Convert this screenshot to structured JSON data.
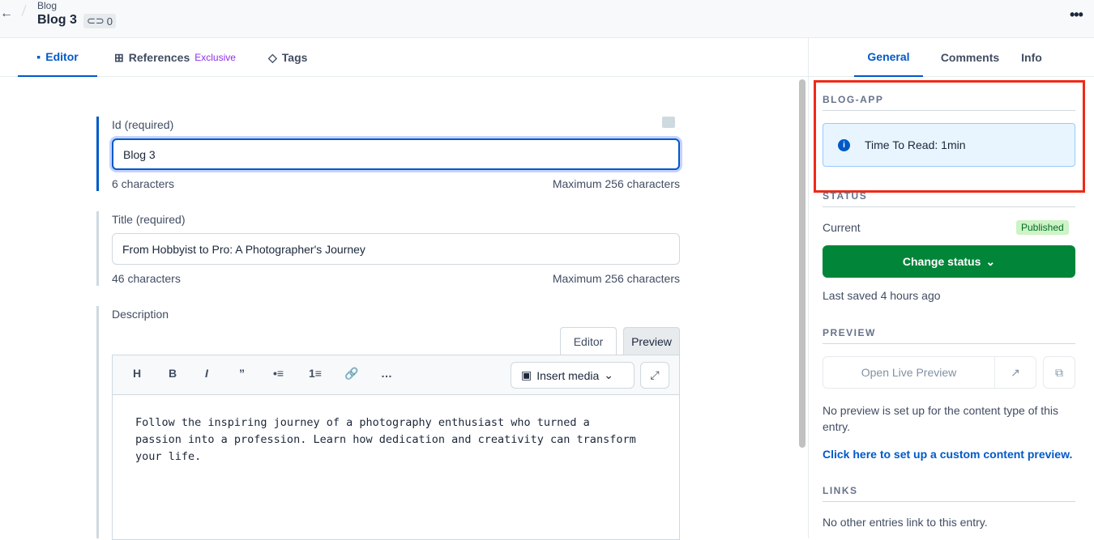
{
  "header": {
    "breadcrumb": "Blog",
    "title": "Blog 3",
    "reference_count": "0",
    "back_icon": "arrow-left-icon",
    "more_icon": "more-horizontal-icon"
  },
  "left_tabs": [
    {
      "label": "Editor",
      "icon": "editor-icon",
      "active": true
    },
    {
      "label": "References",
      "suffix": "Exclusive",
      "icon": "references-icon",
      "active": false
    },
    {
      "label": "Tags",
      "icon": "tag-icon",
      "active": false
    }
  ],
  "fields": {
    "id": {
      "label": "Id (required)",
      "value": "Blog 3",
      "count": "6 characters",
      "max": "Maximum 256 characters"
    },
    "title": {
      "label": "Title (required)",
      "value": "From Hobbyist to Pro: A Photographer's Journey",
      "count": "46 characters",
      "max": "Maximum 256 characters"
    },
    "description": {
      "label": "Description",
      "mode_editor": "Editor",
      "mode_preview": "Preview",
      "insert_media": "Insert media",
      "toolbar": [
        "H",
        "B",
        "I",
        "”",
        "•≡",
        "1≡",
        "🔗",
        "…"
      ],
      "text": "Follow the inspiring journey of a photography enthusiast who turned a\npassion into a profession. Learn how dedication and creativity can transform\nyour life."
    }
  },
  "right_tabs": [
    {
      "label": "General",
      "active": true
    },
    {
      "label": "Comments",
      "active": false
    },
    {
      "label": "Info",
      "active": false
    }
  ],
  "sidebar": {
    "blog_app": {
      "title": "BLOG-APP",
      "note": "Time To Read: 1min"
    },
    "status": {
      "title": "STATUS",
      "current_label": "Current",
      "badge": "Published",
      "button": "Change status",
      "last_saved": "Last saved 4 hours ago"
    },
    "preview": {
      "title": "PREVIEW",
      "button": "Open Live Preview",
      "message": "No preview is set up for the content type of this entry.",
      "link": "Click here to set up a custom content preview."
    },
    "links": {
      "title": "LINKS",
      "message": "No other entries link to this entry."
    }
  },
  "colors": {
    "accent": "#0059c8",
    "success": "#008539",
    "highlight": "#ee2a17"
  }
}
